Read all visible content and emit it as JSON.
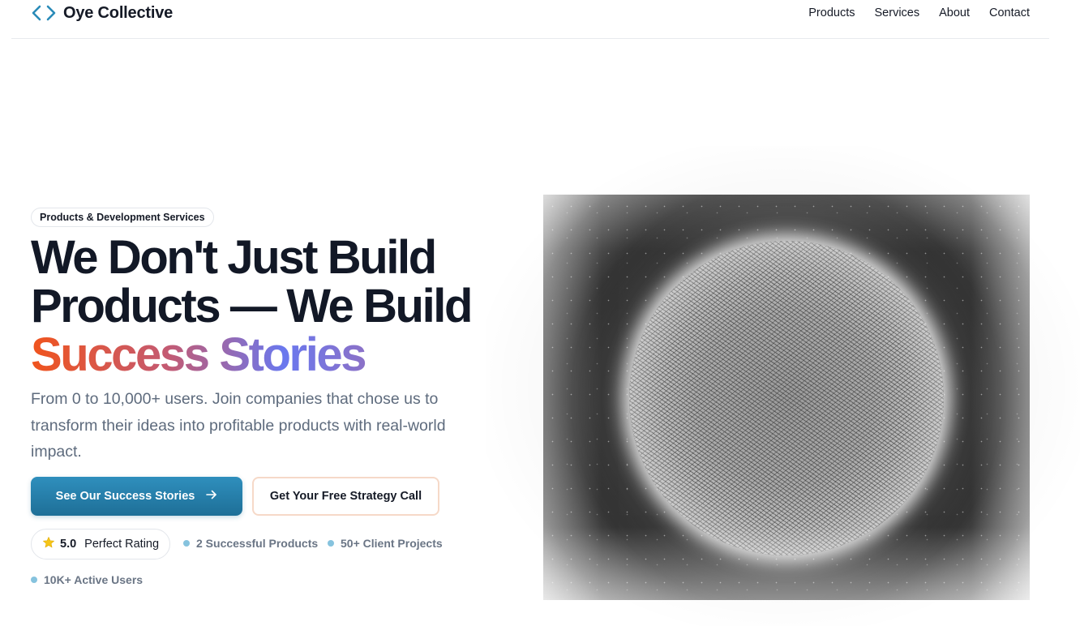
{
  "header": {
    "brand_name": "Oye Collective",
    "brand_icon": "code-brackets-icon",
    "brand_color": "#2a8bb8",
    "nav": [
      {
        "label": "Products"
      },
      {
        "label": "Services"
      },
      {
        "label": "About"
      },
      {
        "label": "Contact"
      }
    ]
  },
  "hero": {
    "badge": "Products & Development Services",
    "headline_line1": "We Don't Just Build",
    "headline_line2": "Products — We Build",
    "headline_highlight": "Success Stories",
    "subtitle": "From 0 to 10,000+ users. Join companies that chose us to transform their ideas into profitable products with real-world impact.",
    "primary_cta": "See Our Success Stories",
    "primary_cta_icon": "arrow-right-icon",
    "secondary_cta": "Get Your Free Strategy Call",
    "rating": {
      "icon": "star-icon",
      "score": "5.0",
      "label": "Perfect Rating"
    },
    "stats": [
      {
        "label": "2 Successful Products"
      },
      {
        "label": "50+ Client Projects"
      },
      {
        "label": "10K+ Active Users"
      }
    ],
    "visual": "particle-sphere-image"
  },
  "colors": {
    "primary_button": "#2684b0",
    "secondary_button_border": "#f6d9c8",
    "stat_dot": "#86c3de",
    "gradient_start": "#f0541d",
    "gradient_mid": "#6a78ee",
    "gradient_end": "#f2561c"
  }
}
